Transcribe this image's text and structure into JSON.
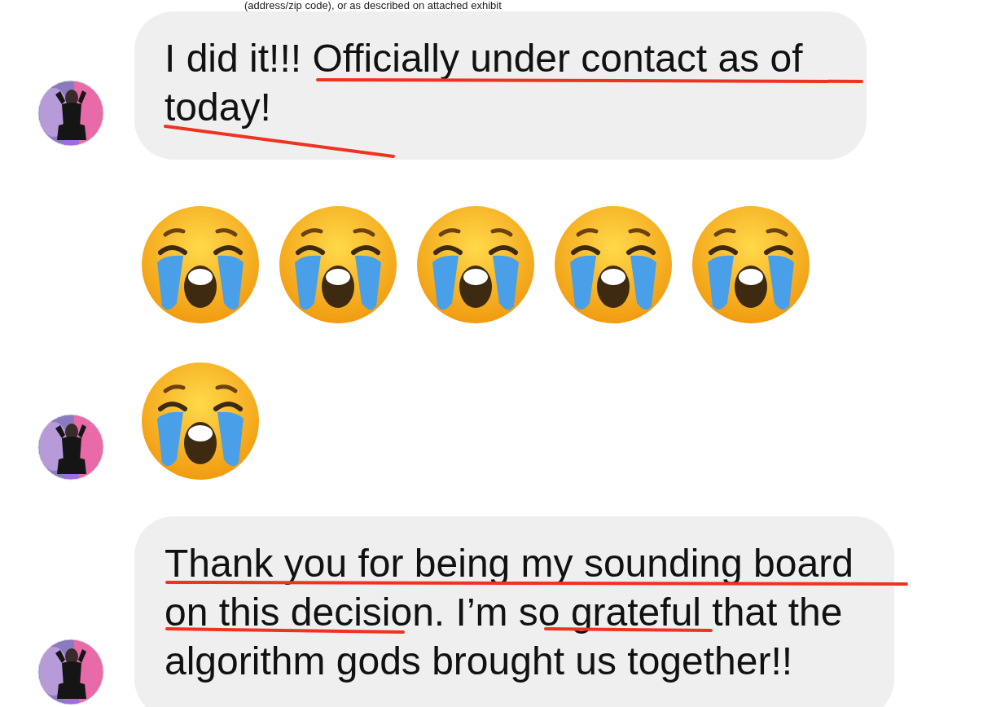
{
  "document_fragment": "(address/zip code), or as described on attached exhibit",
  "messages": [
    {
      "kind": "text",
      "avatar": true,
      "lines": [
        "I did it!!! Officially under contact as of",
        "today!"
      ]
    },
    {
      "kind": "emoji",
      "avatar": false,
      "items": [
        {
          "kind": "loudly-crying"
        },
        {
          "kind": "loudly-crying"
        },
        {
          "kind": "loudly-crying"
        },
        {
          "kind": "loudly-crying"
        },
        {
          "kind": "loudly-crying"
        }
      ]
    },
    {
      "kind": "emoji",
      "avatar": true,
      "items": [
        {
          "kind": "loudly-crying"
        }
      ]
    },
    {
      "kind": "text",
      "avatar": true,
      "lines": [
        "Thank you for being my sounding board",
        "on this decision. I’m so grateful that the",
        "algorithm gods brought us together!!"
      ]
    }
  ]
}
